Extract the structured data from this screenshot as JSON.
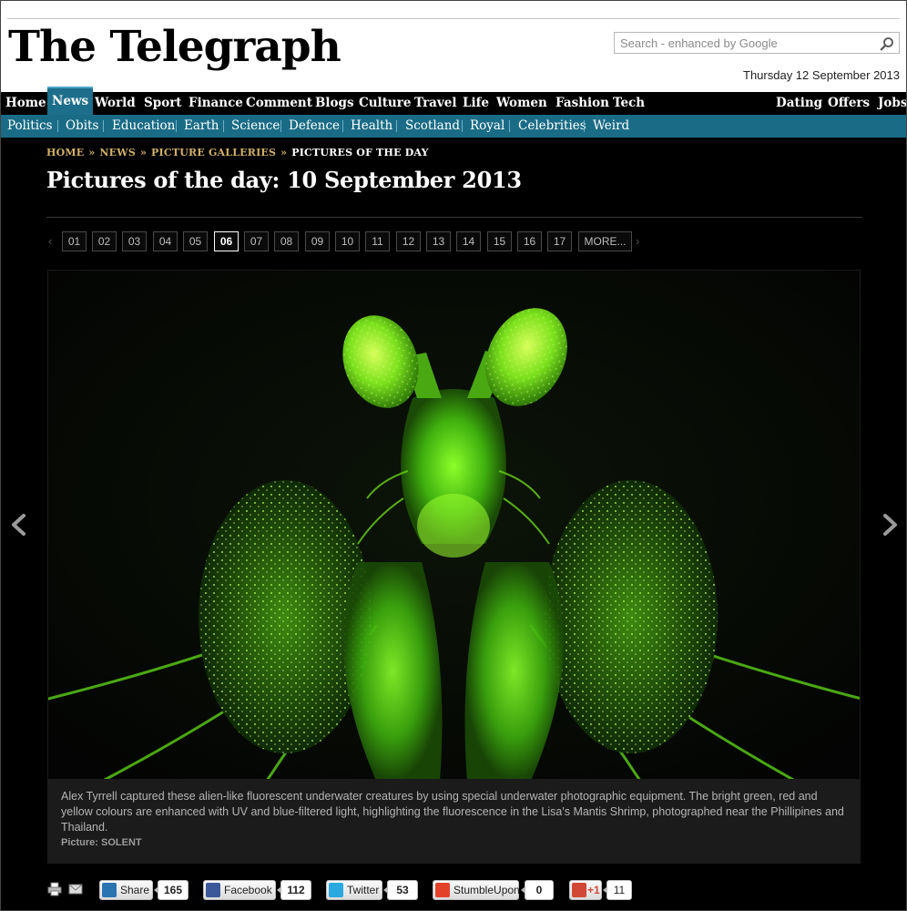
{
  "header": {
    "logo": "The Telegraph",
    "search_placeholder": "Search - enhanced by Google",
    "date": "Thursday 12 September 2013"
  },
  "nav_primary": [
    "Home",
    "News",
    "World",
    "Sport",
    "Finance",
    "Comment",
    "Blogs",
    "Culture",
    "Travel",
    "Life",
    "Women",
    "Fashion",
    "Tech"
  ],
  "nav_primary_active": "News",
  "nav_primary_right": [
    "Dating",
    "Offers",
    "Jobs"
  ],
  "nav_secondary": [
    "Politics",
    "Obits",
    "Education",
    "Earth",
    "Science",
    "Defence",
    "Health",
    "Scotland",
    "Royal",
    "Celebrities",
    "Weird"
  ],
  "breadcrumb": [
    "HOME",
    "NEWS",
    "PICTURE GALLERIES",
    "PICTURES OF THE DAY"
  ],
  "page_title": "Pictures of the day: 10 September 2013",
  "pager": {
    "pages": [
      "01",
      "02",
      "03",
      "04",
      "05",
      "06",
      "07",
      "08",
      "09",
      "10",
      "11",
      "12",
      "13",
      "14",
      "15",
      "16",
      "17"
    ],
    "active": "06",
    "more_label": "MORE..."
  },
  "caption": {
    "text": "Alex Tyrrell captured these alien-like fluorescent underwater creatures by using special underwater photographic equipment. The bright green, red and yellow colours are enhanced with UV and blue-filtered light, highlighting the fluorescence in the Lisa's Mantis Shrimp, photographed near the Phillipines and Thailand.",
    "credit": "Picture: SOLENT"
  },
  "share": [
    {
      "label": "Share",
      "count": "165",
      "icon": "linkedin-icon",
      "color": "#2a74b2"
    },
    {
      "label": "Facebook",
      "count": "112",
      "icon": "facebook-icon",
      "color": "#3b5998"
    },
    {
      "label": "Twitter",
      "count": "53",
      "icon": "twitter-icon",
      "color": "#2aa9e0"
    },
    {
      "label": "StumbleUpon",
      "count": "0",
      "icon": "stumbleupon-icon",
      "color": "#e4412a"
    },
    {
      "label": "+1",
      "count": "11",
      "icon": "google-plus-icon",
      "color": "#d14836"
    }
  ],
  "colors": {
    "nav_primary_bg": "#000000",
    "nav_secondary_bg": "#1a6c86",
    "nav_active_bg": "#1d6e8a",
    "breadcrumb_link": "#d2b066",
    "page_bg": "#000000"
  }
}
